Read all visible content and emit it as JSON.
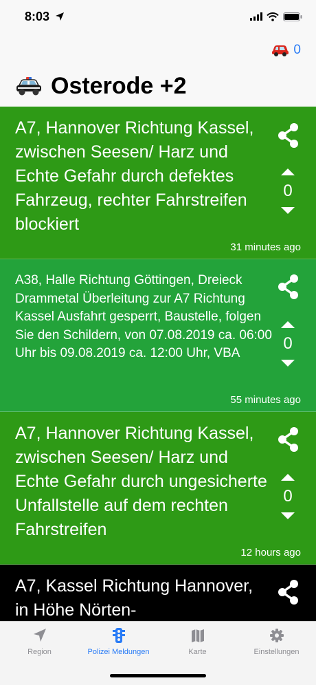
{
  "status": {
    "time": "8:03"
  },
  "header": {
    "car_count": "0",
    "title": "Osterode +2"
  },
  "colors": {
    "card_dark_green": "#2e9a16",
    "card_green": "#23a33a",
    "card_black": "#000000",
    "accent": "#2a7cf6"
  },
  "messages": [
    {
      "text": "A7, Hannover Richtung Kassel, zwischen Seesen/ Harz und Echte Gefahr durch defektes Fahrzeug, rechter Fahrstreifen blockiert",
      "time": "31 minutes ago",
      "votes": "0"
    },
    {
      "text": "A38, Halle Richtung Göttingen, Dreieck Drammetal Überleitung zur A7 Richtung Kassel Ausfahrt gesperrt, Baustelle, folgen Sie den Schildern, von 07.08.2019 ca. 06:00 Uhr bis 09.08.2019 ca. 12:00 Uhr, VBA",
      "time": "55 minutes ago",
      "votes": "0"
    },
    {
      "text": "A7, Hannover Richtung Kassel, zwischen Seesen/ Harz und Echte Gefahr durch ungesicherte Unfallstelle auf dem rechten Fahrstreifen",
      "time": "12 hours ago",
      "votes": "0"
    },
    {
      "text": "A7, Kassel Richtung Hannover, in Höhe Nörten-"
    }
  ],
  "tabs": [
    {
      "label": "Region",
      "icon": "location-arrow-icon"
    },
    {
      "label": "Polizei Meldungen",
      "icon": "traffic-light-icon"
    },
    {
      "label": "Karte",
      "icon": "map-icon"
    },
    {
      "label": "Einstellungen",
      "icon": "gear-icon"
    }
  ]
}
